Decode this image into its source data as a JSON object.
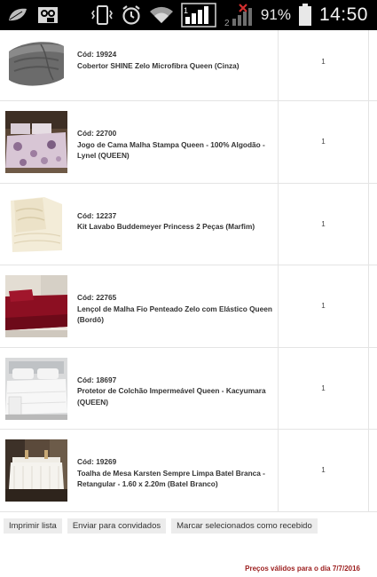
{
  "statusbar": {
    "battery_pct": "91%",
    "time": "14:50",
    "signal_label": "2"
  },
  "items": [
    {
      "code": "Cód: 19924",
      "name": "Cobertor SHINE Zelo Microfibra Queen (Cinza)",
      "qty": "1",
      "thumb": "grey-blanket"
    },
    {
      "code": "Cód: 22700",
      "name": "Jogo de Cama Malha Stampa Queen - 100% Algodão - Lynel (QUEEN)",
      "qty": "1",
      "thumb": "floral-bedding"
    },
    {
      "code": "Cód: 12237",
      "name": "Kit Lavabo Buddemeyer Princess 2 Peças (Marfim)",
      "qty": "1",
      "thumb": "ivory-towels"
    },
    {
      "code": "Cód: 22765",
      "name": "Lençol de Malha Fio Penteado Zelo com Elástico Queen (Bordô)",
      "qty": "1",
      "thumb": "burgundy-sheet"
    },
    {
      "code": "Cód: 18697",
      "name": "Protetor de Colchão Impermeável Queen - Kacyumara (QUEEN)",
      "qty": "1",
      "thumb": "white-bed-protector"
    },
    {
      "code": "Cód: 19269",
      "name": "Toalha de Mesa Karsten Sempre Limpa Batel Branca - Retangular - 1.60 x 2.20m (Batel Branco)",
      "qty": "1",
      "thumb": "white-tablecloth"
    }
  ],
  "actions": {
    "print_label": "Imprimir lista",
    "send_label": "Enviar para convidados",
    "mark_label": "Marcar selecionados como recebido"
  },
  "footer": {
    "validity": "Preços válidos para o dia 7/7/2016"
  },
  "colors": {
    "validity": "#9b1c1c",
    "button_bg": "#ececec"
  }
}
